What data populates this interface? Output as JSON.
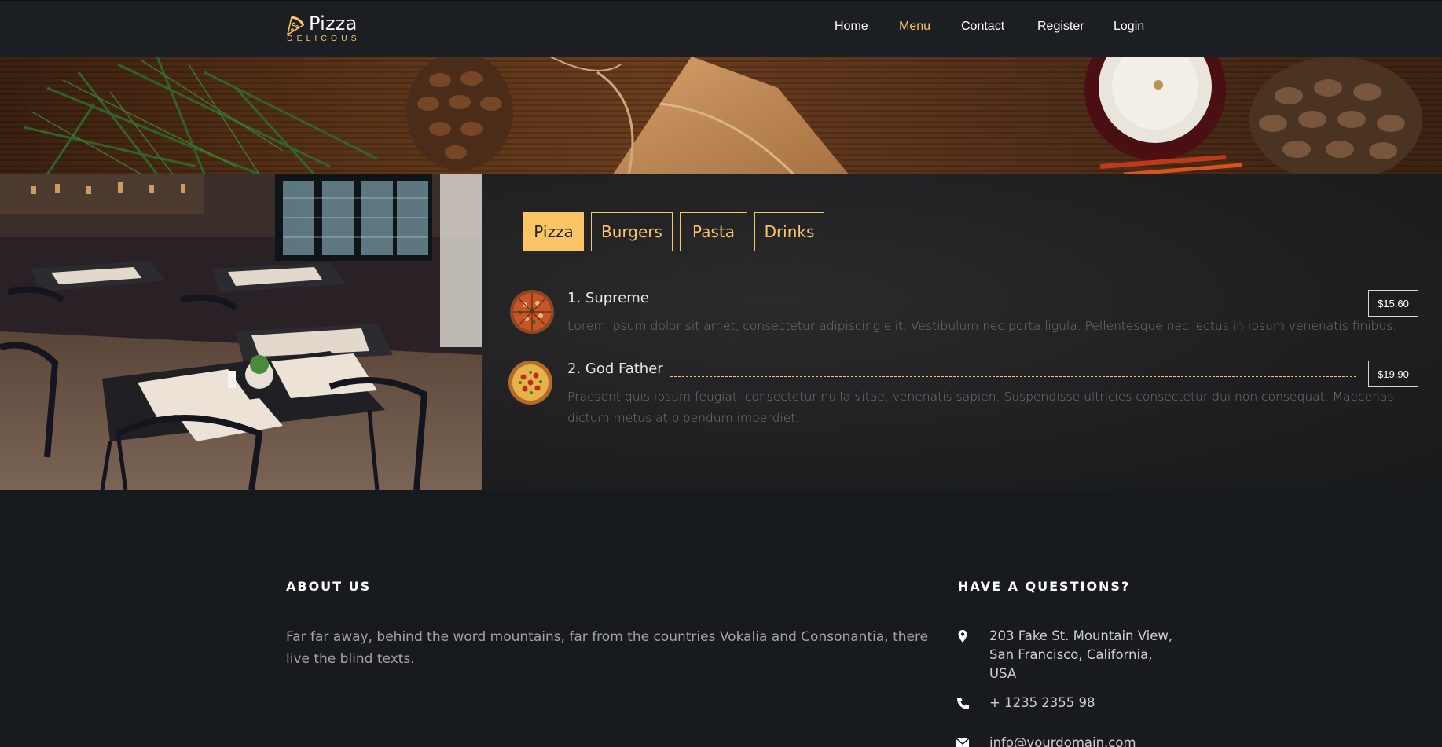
{
  "brand": {
    "title": "Pizza",
    "subtitle": "DELICOUS",
    "accent": "#fac564"
  },
  "nav": {
    "items": [
      {
        "label": "Home",
        "active": false
      },
      {
        "label": "Menu",
        "active": true
      },
      {
        "label": "Contact",
        "active": false
      },
      {
        "label": "Register",
        "active": false
      },
      {
        "label": "Login",
        "active": false
      }
    ]
  },
  "tabs": [
    {
      "label": "Pizza",
      "active": true
    },
    {
      "label": "Burgers",
      "active": false
    },
    {
      "label": "Pasta",
      "active": false
    },
    {
      "label": "Drinks",
      "active": false
    }
  ],
  "menu_items": [
    {
      "name": "1. Supreme",
      "price": "$15.60",
      "description": "Lorem ipsum dolor sit amet, consectetur adipiscing elit. Vestibulum nec porta ligula. Pellentesque nec lectus in ipsum venenatis finibus."
    },
    {
      "name": "2. God Father",
      "price": "$19.90",
      "description": "Praesent quis ipsum feugiat, consectetur nulla vitae, venenatis sapien. Suspendisse ultricies consectetur dui non consequat. Maecenas dictum metus at bibendum imperdiet."
    }
  ],
  "footer": {
    "about": {
      "heading": "ABOUT US",
      "text": "Far far away, behind the word mountains, far from the countries Vokalia and Consonantia, there live the blind texts."
    },
    "questions": {
      "heading": "HAVE A QUESTIONS?",
      "address_line1": "203 Fake St. Mountain View,",
      "address_line2": "San Francisco, California,",
      "address_line3": "USA",
      "phone": "+ 1235 2355 98",
      "email": "info@yourdomain.com"
    }
  }
}
